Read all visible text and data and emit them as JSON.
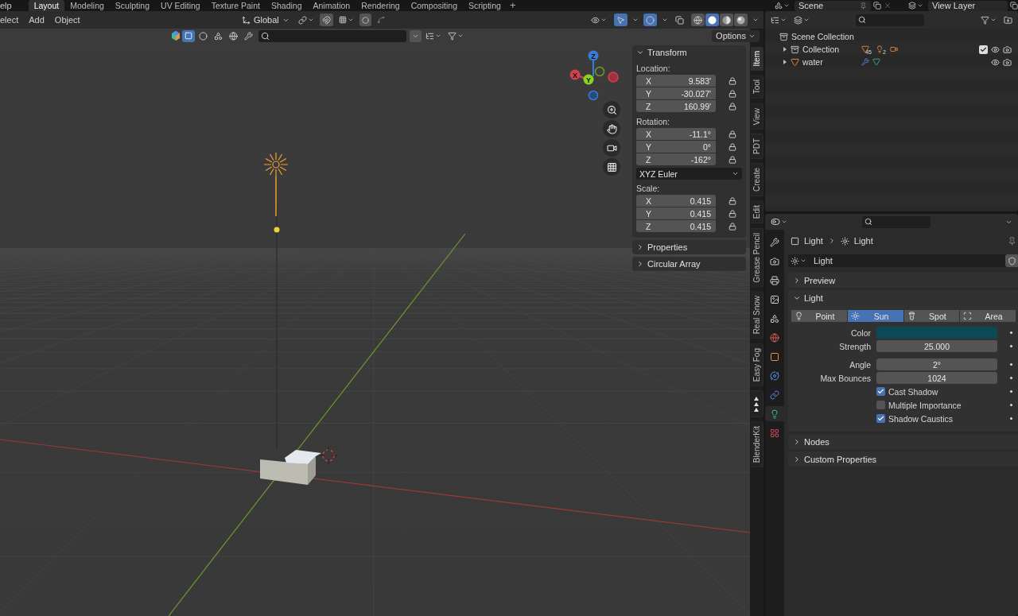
{
  "top_bar": {
    "menu": "elp",
    "workspaces": [
      {
        "label": "Layout",
        "selected": true
      },
      {
        "label": "Modeling",
        "selected": false
      },
      {
        "label": "Sculpting",
        "selected": false
      },
      {
        "label": "UV Editing",
        "selected": false
      },
      {
        "label": "Texture Paint",
        "selected": false
      },
      {
        "label": "Shading",
        "selected": false
      },
      {
        "label": "Animation",
        "selected": false
      },
      {
        "label": "Rendering",
        "selected": false
      },
      {
        "label": "Compositing",
        "selected": false
      },
      {
        "label": "Scripting",
        "selected": false
      }
    ],
    "add_workspace": "+",
    "scene": "Scene",
    "view_layer": "View Layer"
  },
  "viewport_header": {
    "menus": [
      "elect",
      "Add",
      "Object"
    ],
    "orientation": "Global",
    "options": "Options"
  },
  "gizmo_axes": [
    "X",
    "Y",
    "Z"
  ],
  "n_panel": {
    "sections": [
      {
        "title": "Transform",
        "expanded": true,
        "groups": [
          {
            "label": "Location:",
            "rows": [
              {
                "axis": "X",
                "value": "9.583'"
              },
              {
                "axis": "Y",
                "value": "-30.027'"
              },
              {
                "axis": "Z",
                "value": "160.99'"
              }
            ]
          },
          {
            "label": "Rotation:",
            "rows": [
              {
                "axis": "X",
                "value": "-11.1°"
              },
              {
                "axis": "Y",
                "value": "0°"
              },
              {
                "axis": "Z",
                "value": "-162°"
              }
            ],
            "mode": "XYZ Euler"
          },
          {
            "label": "Scale:",
            "rows": [
              {
                "axis": "X",
                "value": "0.415"
              },
              {
                "axis": "Y",
                "value": "0.415"
              },
              {
                "axis": "Z",
                "value": "0.415"
              }
            ]
          }
        ]
      },
      {
        "title": "Properties",
        "expanded": false
      },
      {
        "title": "Circular Array",
        "expanded": false
      }
    ]
  },
  "side_tabs": [
    {
      "kind": "text",
      "label": "Item",
      "selected": true
    },
    {
      "kind": "text",
      "label": "Tool",
      "selected": false
    },
    {
      "kind": "text",
      "label": "View",
      "selected": false
    },
    {
      "kind": "text",
      "label": "PDT",
      "selected": false
    },
    {
      "kind": "text",
      "label": "Create",
      "selected": false
    },
    {
      "kind": "text",
      "label": "Edit",
      "selected": false
    },
    {
      "kind": "text",
      "label": "Grease Pencil",
      "selected": false
    },
    {
      "kind": "text",
      "label": "Real Snow",
      "selected": false
    },
    {
      "kind": "text",
      "label": "Easy Fog",
      "selected": false
    },
    {
      "kind": "icon",
      "selected": false
    },
    {
      "kind": "text",
      "label": "BlenderKit",
      "selected": false
    }
  ],
  "outliner": {
    "root": "Scene Collection",
    "items": [
      {
        "kind": "collection",
        "name": "Collection",
        "expanded": false,
        "checked": true,
        "counts": [
          "45",
          "2"
        ]
      },
      {
        "kind": "object",
        "name": "water",
        "expanded": false
      }
    ]
  },
  "properties": {
    "tabs": [
      {
        "kind": "tool",
        "selected": false
      },
      {
        "kind": "render",
        "selected": false
      },
      {
        "kind": "output",
        "selected": false
      },
      {
        "kind": "view_layer",
        "selected": false
      },
      {
        "kind": "scene",
        "selected": false
      },
      {
        "kind": "world",
        "selected": false
      },
      {
        "kind": "object",
        "selected": false
      },
      {
        "kind": "physics",
        "selected": false
      },
      {
        "kind": "constraints",
        "selected": false
      },
      {
        "kind": "data",
        "selected": true
      },
      {
        "kind": "texture",
        "selected": false
      }
    ],
    "breadcrumb": [
      "Light",
      "Light"
    ],
    "datablock": "Light",
    "panels": [
      {
        "title": "Preview",
        "expanded": false
      },
      {
        "title": "Light",
        "expanded": true,
        "types": [
          {
            "kind": "point",
            "label": "Point",
            "selected": false
          },
          {
            "kind": "sun",
            "label": "Sun",
            "selected": true
          },
          {
            "kind": "spot",
            "label": "Spot",
            "selected": false
          },
          {
            "kind": "area",
            "label": "Area",
            "selected": false
          }
        ],
        "rows": [
          {
            "kind": "color",
            "label": "Color",
            "color": "#0b4a55"
          },
          {
            "kind": "number",
            "label": "Strength",
            "value": "25.000"
          },
          {
            "kind": "number",
            "label": "Angle",
            "value": "2°"
          },
          {
            "kind": "number",
            "label": "Max Bounces",
            "value": "1024"
          },
          {
            "kind": "checkbox",
            "label": "Cast Shadow",
            "checked": true
          },
          {
            "kind": "checkbox",
            "label": "Multiple Importance",
            "checked": false
          },
          {
            "kind": "checkbox",
            "label": "Shadow Caustics",
            "checked": true
          }
        ]
      },
      {
        "title": "Nodes",
        "expanded": false
      },
      {
        "title": "Custom Properties",
        "expanded": false
      }
    ]
  }
}
